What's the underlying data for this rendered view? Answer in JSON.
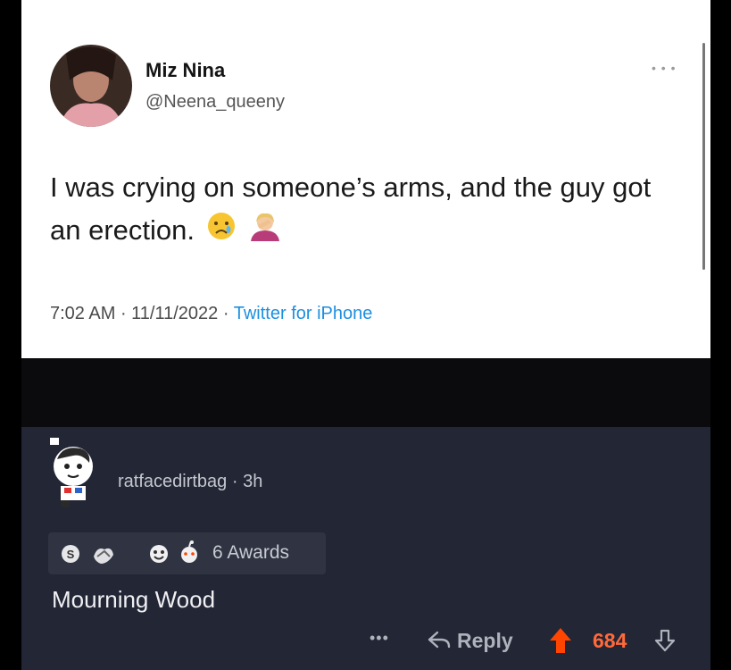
{
  "tweet": {
    "display_name": "Miz Nina",
    "handle": "@Neena_queeny",
    "text": "I was crying on someone’s arms, and the guy got an erection.",
    "emojis": [
      "crying-face-emoji",
      "facepalm-emoji"
    ],
    "time": "7:02 AM",
    "date": "11/11/2022",
    "source": "Twitter for iPhone",
    "more_icon": "more-dots-icon"
  },
  "comment": {
    "username": "ratfacedirtbag",
    "age": "3h",
    "awards_label": "6 Awards",
    "body": "Mourning Wood",
    "reply_label": "Reply",
    "score": "684",
    "colors": {
      "upvote": "#ff4500",
      "score": "#ff6a3a",
      "background": "#222635"
    }
  }
}
